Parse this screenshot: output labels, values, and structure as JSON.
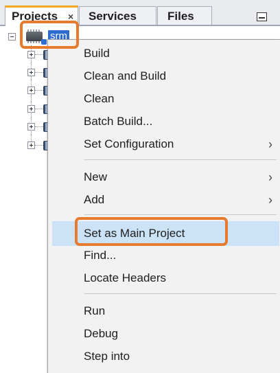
{
  "tabs": {
    "projects": "Projects",
    "projects_close": "×",
    "services": "Services",
    "files": "Files"
  },
  "tree": {
    "project_name": "srm"
  },
  "menu": {
    "items": [
      {
        "label": "Build",
        "submenu": false
      },
      {
        "label": "Clean and Build",
        "submenu": false
      },
      {
        "label": "Clean",
        "submenu": false
      },
      {
        "label": "Batch Build...",
        "submenu": false
      },
      {
        "label": "Set Configuration",
        "submenu": true
      },
      {
        "label": "New",
        "submenu": true
      },
      {
        "label": "Add",
        "submenu": true
      },
      {
        "label": "Set as Main Project",
        "submenu": false,
        "selected": true
      },
      {
        "label": "Find...",
        "submenu": false
      },
      {
        "label": "Locate Headers",
        "submenu": false
      },
      {
        "label": "Run",
        "submenu": false
      },
      {
        "label": "Debug",
        "submenu": false
      },
      {
        "label": "Step into",
        "submenu": false
      }
    ],
    "submenu_chevron": "›"
  },
  "colors": {
    "active_tab_accent": "#f5a623",
    "selection_label_bg": "#2c6bd0",
    "menu_hover_bg": "#cce2f7",
    "highlight_outline": "#e67a2e"
  },
  "icons": [
    "chip-icon",
    "folder-icon",
    "minimize-icon",
    "close-icon",
    "chevron-right-icon",
    "expand-icon",
    "collapse-icon"
  ]
}
